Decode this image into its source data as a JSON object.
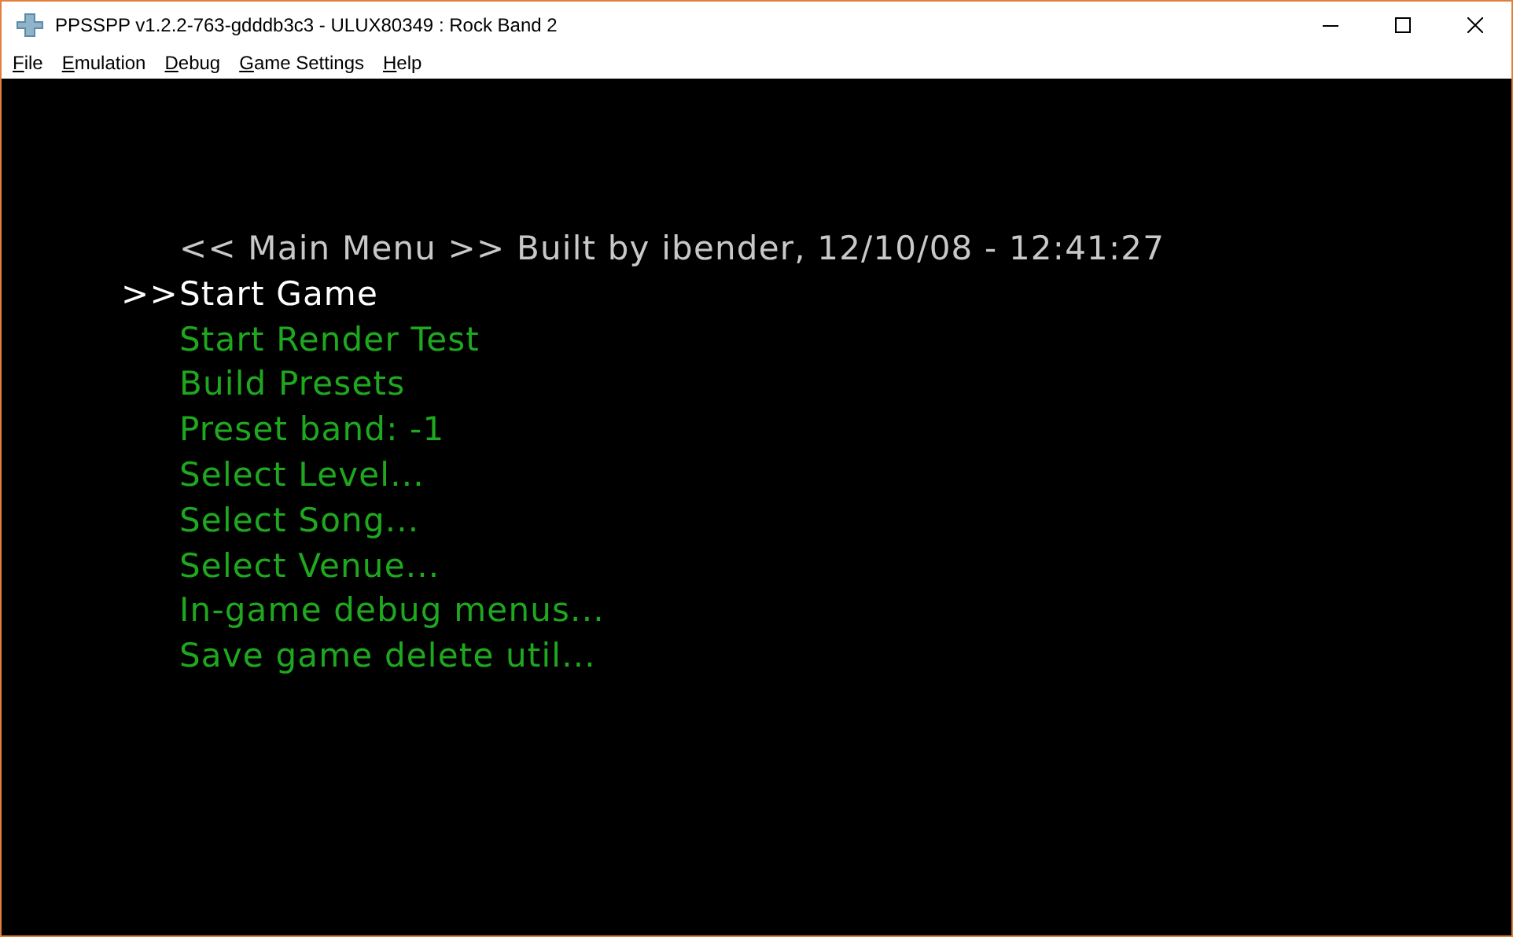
{
  "window": {
    "title": "PPSSPP v1.2.2-763-gdddb3c3 - ULUX80349 : Rock Band 2"
  },
  "menu_bar": [
    "File",
    "Emulation",
    "Debug",
    "Game Settings",
    "Help"
  ],
  "game_screen": {
    "header": "<< Main Menu >> Built by ibender, 12/10/08 - 12:41:27",
    "cursor": ">>",
    "items": [
      {
        "label": "Start Game",
        "selected": true
      },
      {
        "label": "Start Render Test",
        "selected": false
      },
      {
        "label": "Build Presets",
        "selected": false
      },
      {
        "label": "Preset band: -1",
        "selected": false
      },
      {
        "label": "Select Level...",
        "selected": false
      },
      {
        "label": "Select Song...",
        "selected": false
      },
      {
        "label": "Select Venue...",
        "selected": false
      },
      {
        "label": "In-game debug menus...",
        "selected": false
      },
      {
        "label": "Save game delete util...",
        "selected": false
      }
    ]
  }
}
